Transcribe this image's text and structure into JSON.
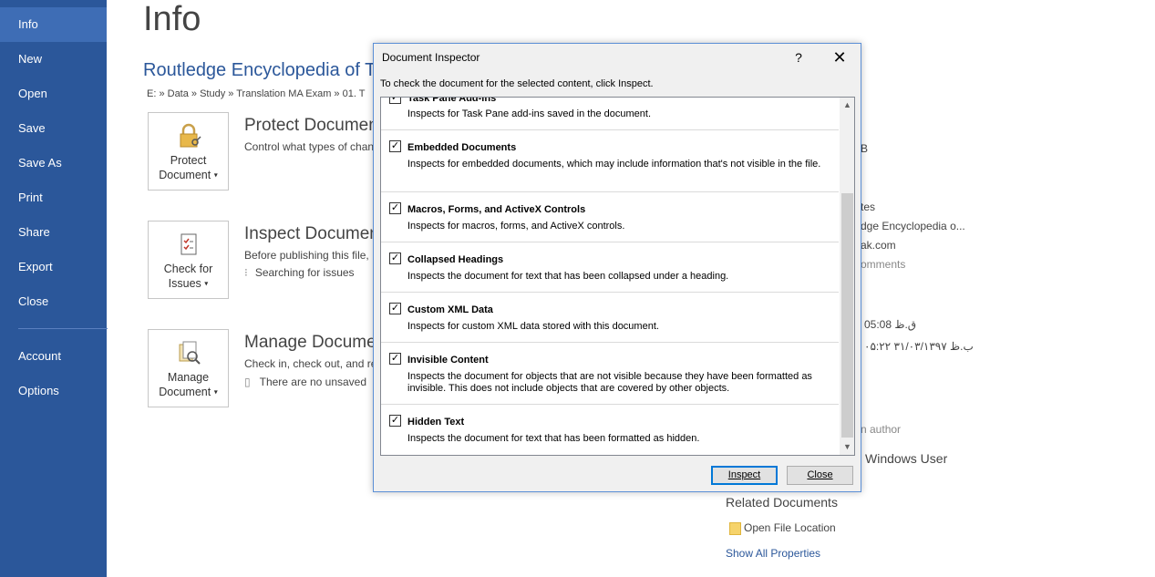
{
  "sidebar": {
    "items": [
      {
        "label": "Info",
        "active": true
      },
      {
        "label": "New"
      },
      {
        "label": "Open"
      },
      {
        "label": "Save"
      },
      {
        "label": "Save As"
      },
      {
        "label": "Print"
      },
      {
        "label": "Share"
      },
      {
        "label": "Export"
      },
      {
        "label": "Close"
      },
      {
        "label": "Account"
      },
      {
        "label": "Options"
      }
    ]
  },
  "main": {
    "title": "Info",
    "doc_title": "Routledge Encyclopedia of T",
    "path": "E: » Data » Study » Translation MA Exam » 01. T",
    "protect": {
      "button": "Protect",
      "button2": "Document",
      "title": "Protect Documen",
      "desc": "Control what types of chan"
    },
    "inspect": {
      "button": "Check for",
      "button2": "Issues",
      "title": "Inspect Documen",
      "desc": "Before publishing this file,",
      "status": "Searching for issues"
    },
    "manage": {
      "button": "Manage",
      "button2": "Document",
      "title": "Manage Docume",
      "desc": "Check in, check out, and re",
      "status": "There are no unsaved"
    }
  },
  "right_panel": {
    "size_fragment": "B",
    "templates_fragment": "tes",
    "title_fragment": "dge Encyclopedia o...",
    "company_fragment": "ak.com",
    "comments_fragment": "omments",
    "date1": "ق.ظ 05:08",
    "date2": "۰۵:۲۲ ب.ظ ۳۱/۰۳/۱۳۹۷",
    "author_fragment": "n author",
    "last_modified_by": "Windows User",
    "related_docs": "Related Documents",
    "open_file_location": "Open File Location",
    "show_all": "Show All Properties"
  },
  "dialog": {
    "title": "Document Inspector",
    "help": "?",
    "instruction": "To check the document for the selected content, click Inspect.",
    "items": [
      {
        "title": "Task Pane Add-ins",
        "desc": "Inspects for Task Pane add-ins saved in the document.",
        "checked": true
      },
      {
        "title": "Embedded Documents",
        "desc": "Inspects for embedded documents, which may include information that's not visible in the file.",
        "checked": true
      },
      {
        "title": "Macros, Forms, and ActiveX Controls",
        "desc": "Inspects for macros, forms, and ActiveX controls.",
        "checked": true
      },
      {
        "title": "Collapsed Headings",
        "desc": "Inspects the document for text that has been collapsed under a heading.",
        "checked": true
      },
      {
        "title": "Custom XML Data",
        "desc": "Inspects for custom XML data stored with this document.",
        "checked": true
      },
      {
        "title": "Invisible Content",
        "desc": "Inspects the document for objects that are not visible because they have been formatted as invisible. This does not include objects that are covered by other objects.",
        "checked": true
      },
      {
        "title": "Hidden Text",
        "desc": "Inspects the document for text that has been formatted as hidden.",
        "checked": true
      }
    ],
    "inspect_label": "Inspect",
    "close_label": "Close"
  }
}
